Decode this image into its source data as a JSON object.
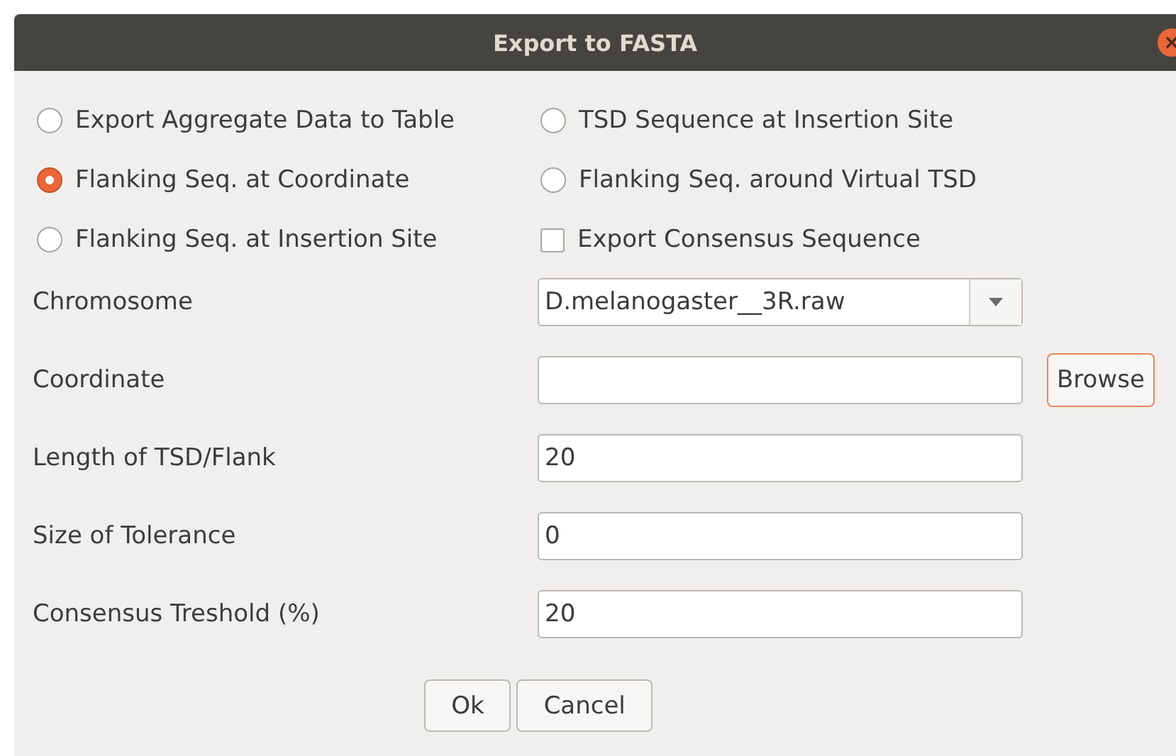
{
  "window": {
    "title": "Export to FASTA"
  },
  "options": [
    {
      "kind": "radio",
      "label": "Export Aggregate Data to Table",
      "checked": false
    },
    {
      "kind": "radio",
      "label": "TSD Sequence at Insertion Site",
      "checked": false
    },
    {
      "kind": "radio",
      "label": "Flanking Seq. at Coordinate",
      "checked": true
    },
    {
      "kind": "radio",
      "label": "Flanking Seq. around Virtual TSD",
      "checked": false
    },
    {
      "kind": "radio",
      "label": "Flanking Seq. at Insertion Site",
      "checked": false
    },
    {
      "kind": "checkbox",
      "label": "Export Consensus Sequence",
      "checked": false
    }
  ],
  "fields": [
    {
      "kind": "select",
      "label": "Chromosome",
      "value": "D.melanogaster__3R.raw"
    },
    {
      "kind": "text",
      "label": "Coordinate",
      "button": "Browse"
    },
    {
      "kind": "text",
      "label": "Length of TSD/Flank",
      "value": "20"
    },
    {
      "kind": "text",
      "label": "Size of Tolerance",
      "value": "0"
    },
    {
      "kind": "text",
      "label": "Consensus Treshold (%)",
      "value": "20"
    }
  ],
  "buttons": [
    "Ok",
    "Cancel"
  ]
}
